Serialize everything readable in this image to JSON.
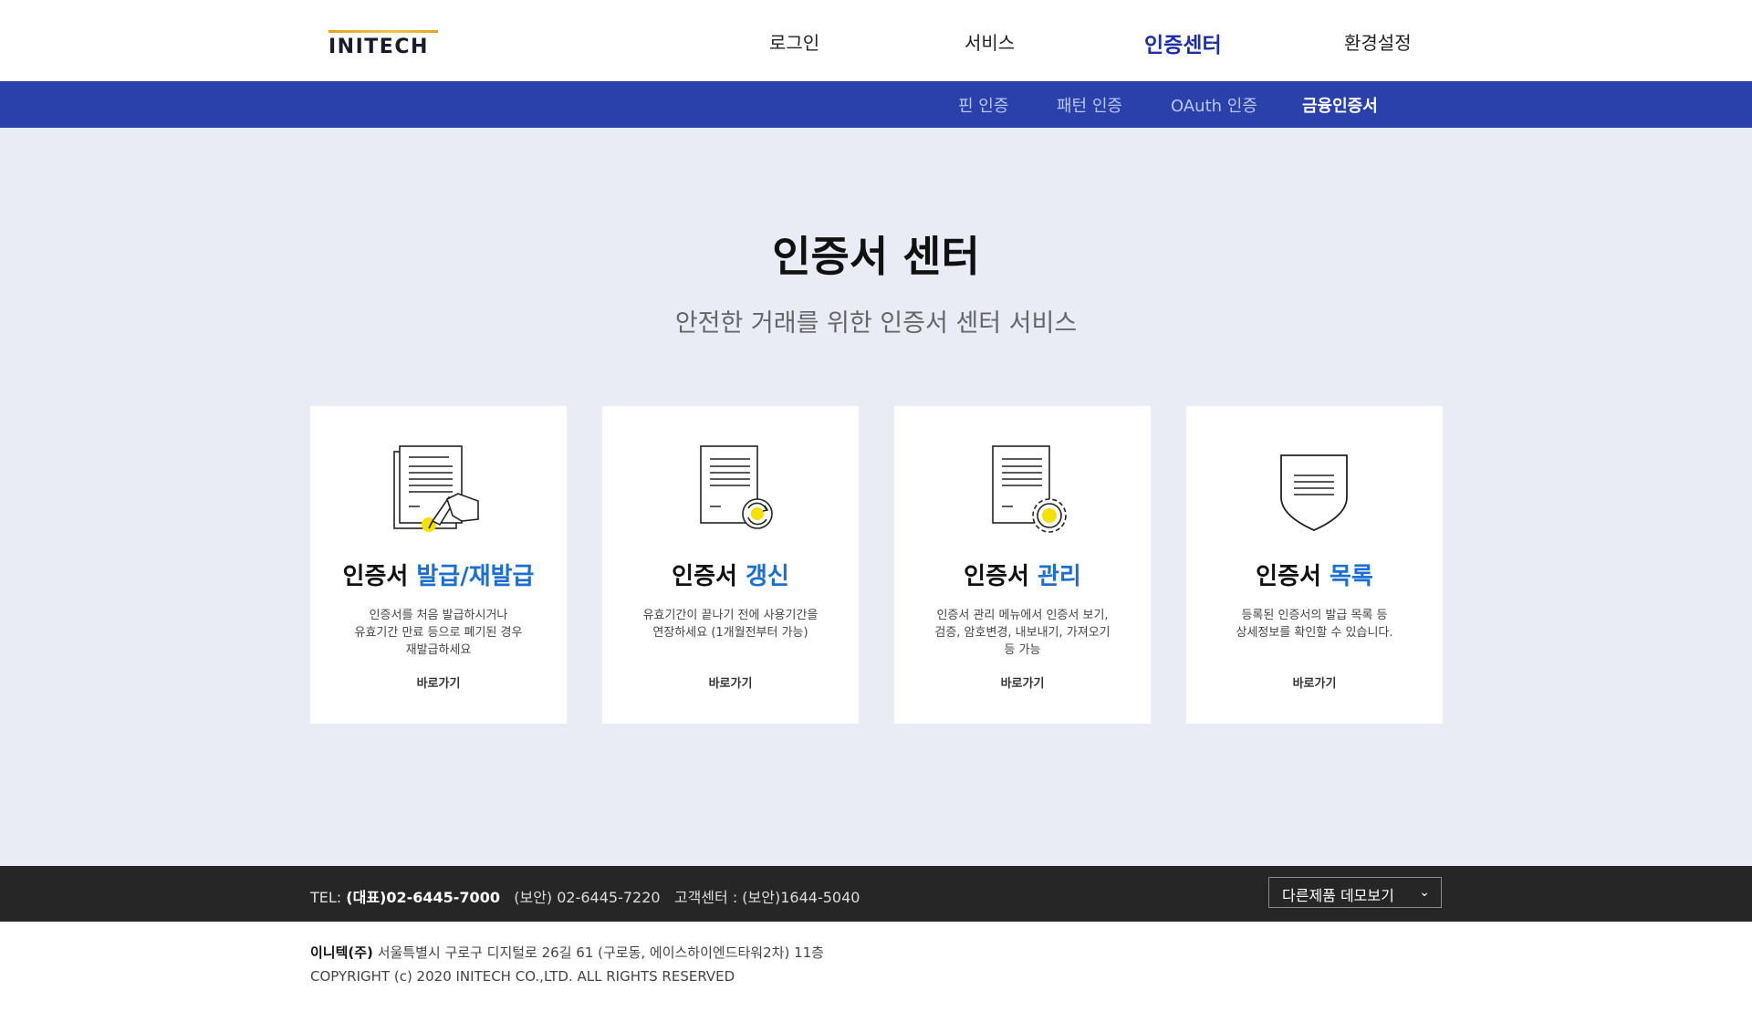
{
  "header": {
    "logo_text": "INITECH",
    "nav": [
      {
        "label": "로그인"
      },
      {
        "label": "서비스"
      },
      {
        "label": "인증센터",
        "active": true
      },
      {
        "label": "환경설정"
      }
    ]
  },
  "subnav": {
    "items": [
      {
        "label": "핀 인증"
      },
      {
        "label": "패턴 인증"
      },
      {
        "label": "OAuth 인증"
      },
      {
        "label": "금융인증서",
        "active": true
      }
    ]
  },
  "main": {
    "title": "인증서 센터",
    "subtitle": "안전한 거래를 위한 인증서 센터 서비스",
    "cards": [
      {
        "icon": "document-pen-icon",
        "title_prefix": "인증서",
        "title_highlight": "발급/재발급",
        "desc": [
          "인증서를 처음 발급하시거나",
          "유효기간 만료 등으로 폐기된 경우",
          "재발급하세요"
        ],
        "link": "바로가기"
      },
      {
        "icon": "document-refresh-icon",
        "title_prefix": "인증서",
        "title_highlight": "갱신",
        "desc": [
          "유효기간이 끝나기 전에 사용기간을",
          "연장하세요 (1개월전부터 가능)"
        ],
        "link": "바로가기"
      },
      {
        "icon": "document-gear-icon",
        "title_prefix": "인증서",
        "title_highlight": "관리",
        "desc": [
          "인증서 관리 메뉴에서 인증서 보기,",
          "검증, 암호변경, 내보내기, 가져오기",
          "등 가능"
        ],
        "link": "바로가기"
      },
      {
        "icon": "shield-list-icon",
        "title_prefix": "인증서",
        "title_highlight": "목록",
        "desc": [
          "등록된 인증서의 발급 목록 등",
          "상세정보를 확인할 수 있습니다."
        ],
        "link": "바로가기"
      }
    ]
  },
  "footer": {
    "tel_label": "TEL:",
    "tel_main": "(대표)02-6445-7000",
    "tel_security": "(보안) 02-6445-7220",
    "tel_center": "고객센터 : (보안)1644-5040",
    "demo_select": "다른제품 데모보기",
    "company": "이니텍(주)",
    "address": "서울특별시 구로구 디지털로 26길 61 (구로동, 에이스하이엔드타워2차) 11층",
    "copyright": "COPYRIGHT (c) 2020 INITECH CO.,LTD. ALL RIGHTS RESERVED"
  },
  "colors": {
    "subnav_bg": "#2a40ab",
    "active_nav": "#1d2fa8",
    "highlight": "#1a6fd1",
    "icon_accent": "#f5d000",
    "main_bg": "#e9ecf4",
    "footer_bg": "#262626"
  }
}
